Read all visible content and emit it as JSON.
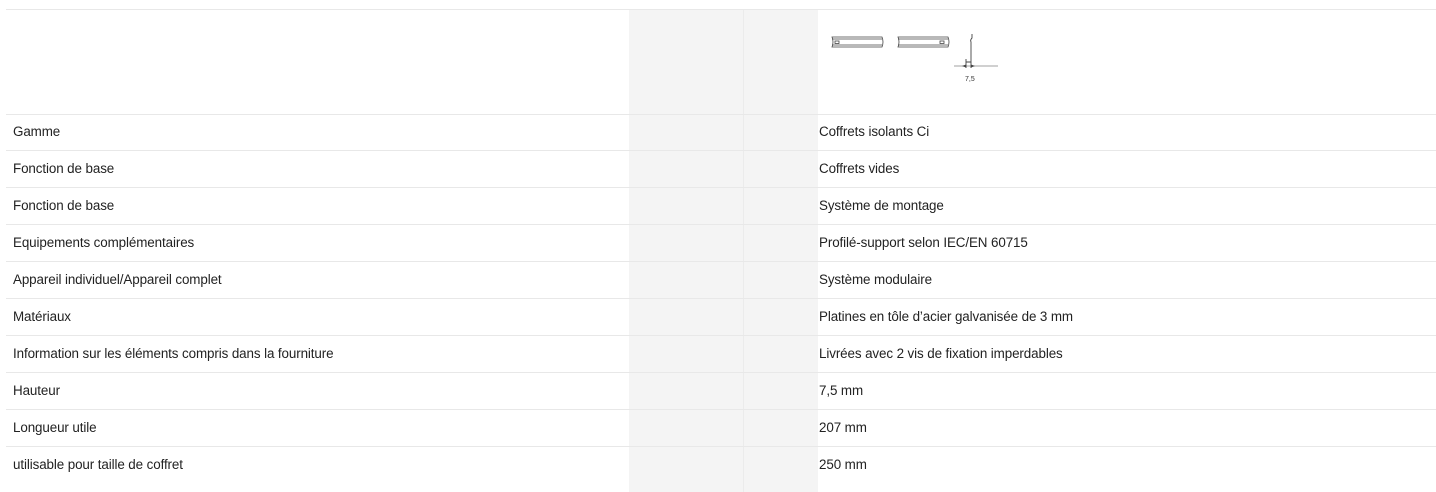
{
  "drawing": {
    "dimension_label": "7,5"
  },
  "rows": [
    {
      "label": "Gamme",
      "value": "Coffrets isolants Ci"
    },
    {
      "label": "Fonction de base",
      "value": "Coffrets vides"
    },
    {
      "label": "Fonction de base",
      "value": "Système de montage"
    },
    {
      "label": "Equipements complémentaires",
      "value": "Profilé-support selon IEC/EN 60715"
    },
    {
      "label": "Appareil individuel/Appareil complet",
      "value": "Système modulaire"
    },
    {
      "label": "Matériaux",
      "value": "Platines en tôle d’acier galvanisée de 3 mm"
    },
    {
      "label": "Information sur les éléments compris dans la fourniture",
      "value": "Livrées avec 2 vis de fixation imperdables"
    },
    {
      "label": "Hauteur",
      "value": "7,5 mm"
    },
    {
      "label": "Longueur utile",
      "value": "207 mm"
    },
    {
      "label": "utilisable pour taille de coffret",
      "value": "250 mm"
    }
  ]
}
